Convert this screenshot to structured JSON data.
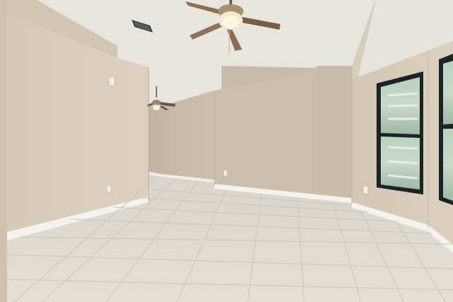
{
  "scene": {
    "description_tags": [
      "empty-room",
      "tile-floor",
      "vaulted-ceiling",
      "ceiling-fans",
      "windows"
    ],
    "colors": {
      "ceiling": "#ebe9e4",
      "wall_light": "#d9cdbb",
      "wall_mid": "#cbbfac",
      "wall_shadow": "#bfb39f",
      "floor": "#ddd8cf",
      "floor_grout": "#c8c2b8",
      "baseboard": "#f4f2ee",
      "window_frame": "#1c2226",
      "window_glass": "#a9c2ae"
    },
    "fixtures": {
      "ceiling_fan_count": 2,
      "window_count": 2,
      "vent_icon": "ceiling-vent-icon",
      "fan_icon": "ceiling-fan-icon"
    }
  }
}
